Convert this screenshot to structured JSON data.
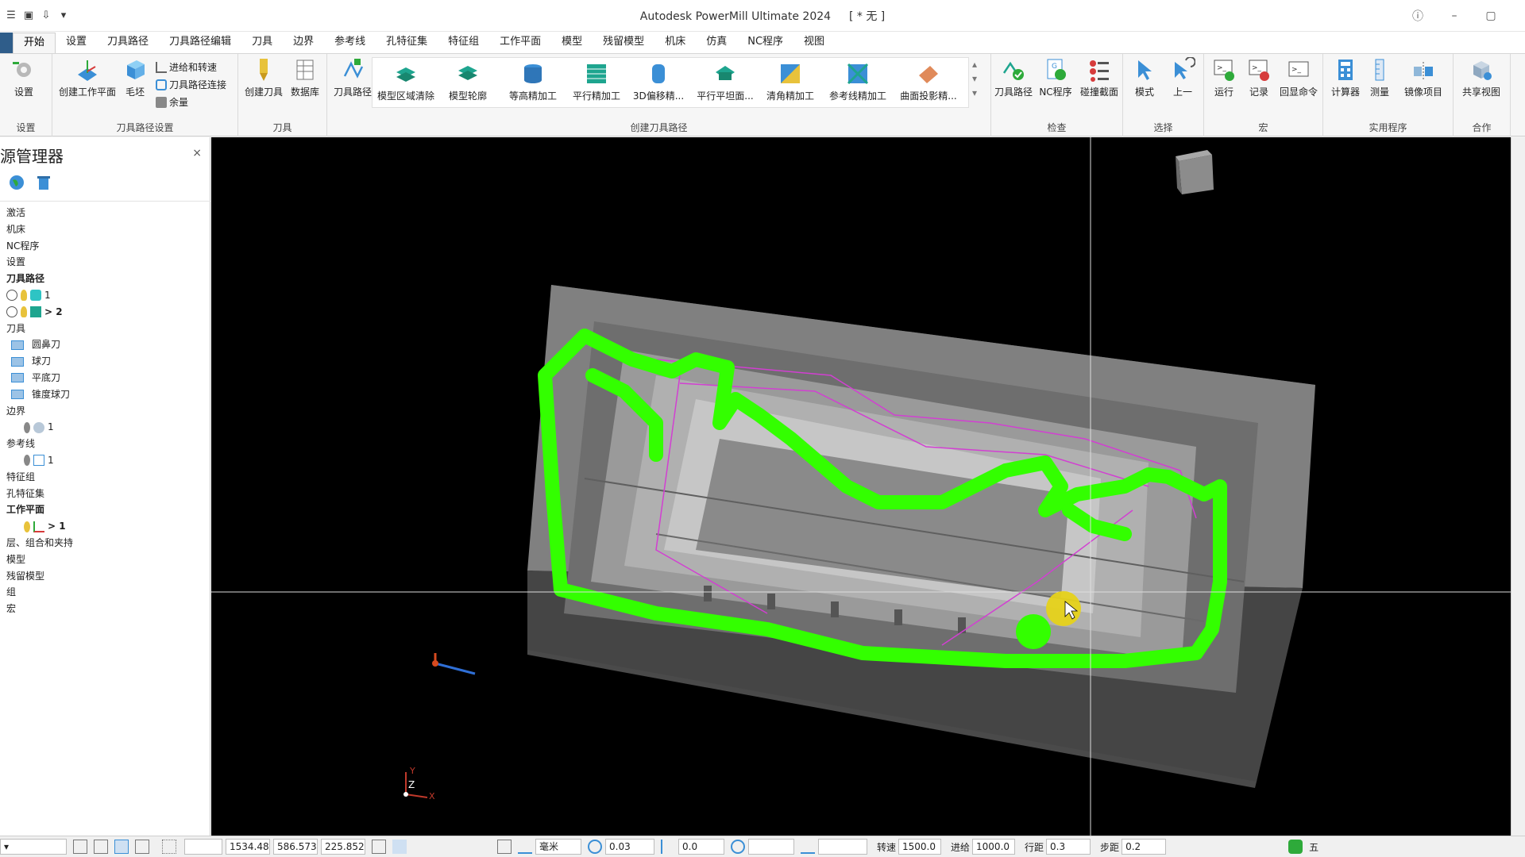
{
  "app": {
    "title": "Autodesk PowerMill Ultimate 2024",
    "document": "[ * 无 ]",
    "help_icon": "question-icon"
  },
  "tabs": [
    {
      "label": "开始",
      "active": true
    },
    {
      "label": "设置"
    },
    {
      "label": "刀具路径"
    },
    {
      "label": "刀具路径编辑"
    },
    {
      "label": "刀具"
    },
    {
      "label": "边界"
    },
    {
      "label": "参考线"
    },
    {
      "label": "孔特征集"
    },
    {
      "label": "特征组"
    },
    {
      "label": "工作平面"
    },
    {
      "label": "模型"
    },
    {
      "label": "残留模型"
    },
    {
      "label": "机床"
    },
    {
      "label": "仿真"
    },
    {
      "label": "NC程序"
    },
    {
      "label": "视图"
    }
  ],
  "ribbon": {
    "groups": {
      "setup": "设置",
      "toolpath_setup": "刀具路径设置",
      "tool": "刀具",
      "create_toolpath": "创建刀具路径",
      "inspect": "检查",
      "select": "选择",
      "macro": "宏",
      "utilities": "实用程序",
      "collaborate": "合作"
    },
    "buttons": {
      "setup": "设置",
      "create_workplane": "创建工作平面",
      "block": "毛坯",
      "leads_links": "进给和转速",
      "toolpath_connections": "刀具路径连接",
      "thickness": "余量",
      "create_tool": "创建刀具",
      "database": "数据库",
      "toolpaths": "刀具路径",
      "model_area_clear": "模型区域清除",
      "model_profile": "模型轮廓",
      "constant_z_finish": "等高精加工",
      "raster_finish": "平行精加工",
      "offset_3d": "3D偏移精...",
      "raster_flat": "平行平坦面...",
      "corner_finish": "清角精加工",
      "pattern_finish": "参考线精加工",
      "surface_projection": "曲面投影精...",
      "inspect_toolpaths": "刀具路径",
      "inspect_nc": "NC程序",
      "collision_section": "碰撞截面",
      "mode": "模式",
      "previous": "上一",
      "run": "运行",
      "record": "记录",
      "echo_commands": "回显命令",
      "calculator": "计算器",
      "measure": "测量",
      "mirror": "镜像项目",
      "share_view": "共享视图"
    }
  },
  "explorer": {
    "title": "源管理器",
    "close": "×",
    "tree": [
      {
        "label": "激活",
        "indent": 0
      },
      {
        "label": "机床",
        "indent": 0
      },
      {
        "label": "NC程序",
        "indent": 0
      },
      {
        "label": "设置",
        "indent": 0
      },
      {
        "label": "刀具路径",
        "indent": 0,
        "bold": true
      },
      {
        "label": "1",
        "indent": 1,
        "type": "toolpath"
      },
      {
        "label": "> 2",
        "indent": 1,
        "type": "toolpath-active",
        "bold": true
      },
      {
        "label": "刀具",
        "indent": 0
      },
      {
        "label": "圆鼻刀",
        "indent": 1,
        "type": "folder"
      },
      {
        "label": "球刀",
        "indent": 1,
        "type": "folder"
      },
      {
        "label": "平底刀",
        "indent": 1,
        "type": "folder"
      },
      {
        "label": "锥度球刀",
        "indent": 1,
        "type": "folder"
      },
      {
        "label": "边界",
        "indent": 0
      },
      {
        "label": "1",
        "indent": 1,
        "type": "boundary"
      },
      {
        "label": "参考线",
        "indent": 0
      },
      {
        "label": "1",
        "indent": 1,
        "type": "pattern"
      },
      {
        "label": "特征组",
        "indent": 0
      },
      {
        "label": "孔特征集",
        "indent": 0
      },
      {
        "label": "工作平面",
        "indent": 0,
        "bold": true
      },
      {
        "label": "> 1",
        "indent": 1,
        "type": "workplane",
        "bold": true
      },
      {
        "label": "层、组合和夹持",
        "indent": 0
      },
      {
        "label": "模型",
        "indent": 0
      },
      {
        "label": "残留模型",
        "indent": 0
      },
      {
        "label": "组",
        "indent": 0
      },
      {
        "label": "宏",
        "indent": 0
      }
    ]
  },
  "viewport": {
    "axis_labels": {
      "y": "Y",
      "z": "Z",
      "x": "X"
    },
    "background": "#000000",
    "toolpath_color": "#33ff00",
    "pattern_color": "#d23fd2"
  },
  "statusbar": {
    "x": "1534.48",
    "y": "586.573",
    "z": "225.852",
    "units": "毫米",
    "tolerance": "0.03",
    "thickness": "0.0",
    "spindle_label": "转速",
    "spindle": "1500.0",
    "feed_label": "进给",
    "feed": "1000.0",
    "stepover_label": "行距",
    "stepover": "0.3",
    "stepdown_label": "步距",
    "stepdown": "0.2",
    "ime": "五"
  }
}
